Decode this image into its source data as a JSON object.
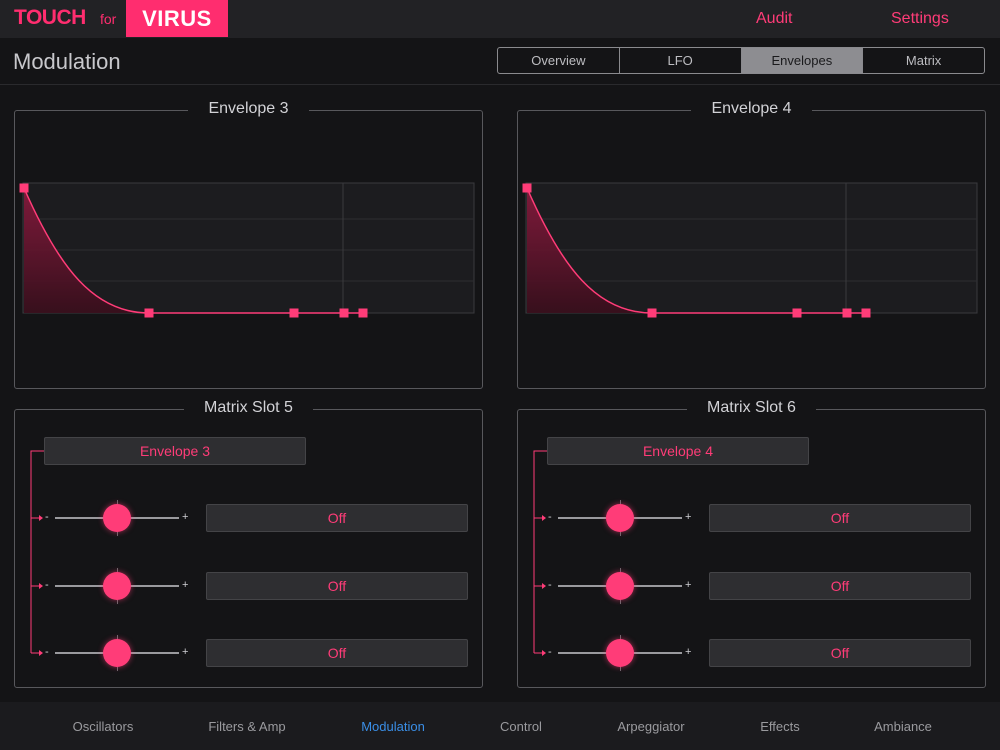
{
  "app": {
    "logo_touch": "TOUCH",
    "logo_for": "for",
    "logo_virus": "VIRUS"
  },
  "topnav": {
    "audit": "Audit",
    "settings": "Settings"
  },
  "header": {
    "title": "Modulation",
    "tabs": [
      {
        "label": "Overview",
        "active": false
      },
      {
        "label": "LFO",
        "active": false
      },
      {
        "label": "Envelopes",
        "active": true
      },
      {
        "label": "Matrix",
        "active": false
      }
    ]
  },
  "envelopes": [
    {
      "title": "Envelope 3"
    },
    {
      "title": "Envelope 4"
    }
  ],
  "matrix_slots": [
    {
      "title": "Matrix Slot 5",
      "source": "Envelope 3",
      "rows": [
        {
          "minus": "-",
          "plus": "+",
          "amount": 0.5,
          "destination": "Off"
        },
        {
          "minus": "-",
          "plus": "+",
          "amount": 0.5,
          "destination": "Off"
        },
        {
          "minus": "-",
          "plus": "+",
          "amount": 0.5,
          "destination": "Off"
        }
      ]
    },
    {
      "title": "Matrix Slot 6",
      "source": "Envelope 4",
      "rows": [
        {
          "minus": "-",
          "plus": "+",
          "amount": 0.5,
          "destination": "Off"
        },
        {
          "minus": "-",
          "plus": "+",
          "amount": 0.5,
          "destination": "Off"
        },
        {
          "minus": "-",
          "plus": "+",
          "amount": 0.5,
          "destination": "Off"
        }
      ]
    }
  ],
  "bottom_tabs": [
    {
      "label": "Oscillators",
      "active": false
    },
    {
      "label": "Filters & Amp",
      "active": false
    },
    {
      "label": "Modulation",
      "active": true
    },
    {
      "label": "Control",
      "active": false
    },
    {
      "label": "Arpeggiator",
      "active": false
    },
    {
      "label": "Effects",
      "active": false
    },
    {
      "label": "Ambiance",
      "active": false
    }
  ],
  "colors": {
    "accent": "#ff3c78",
    "active_tab": "#3a8ee6",
    "background": "#141416"
  },
  "icons": {
    "routing": "routing-arrow-icon"
  }
}
